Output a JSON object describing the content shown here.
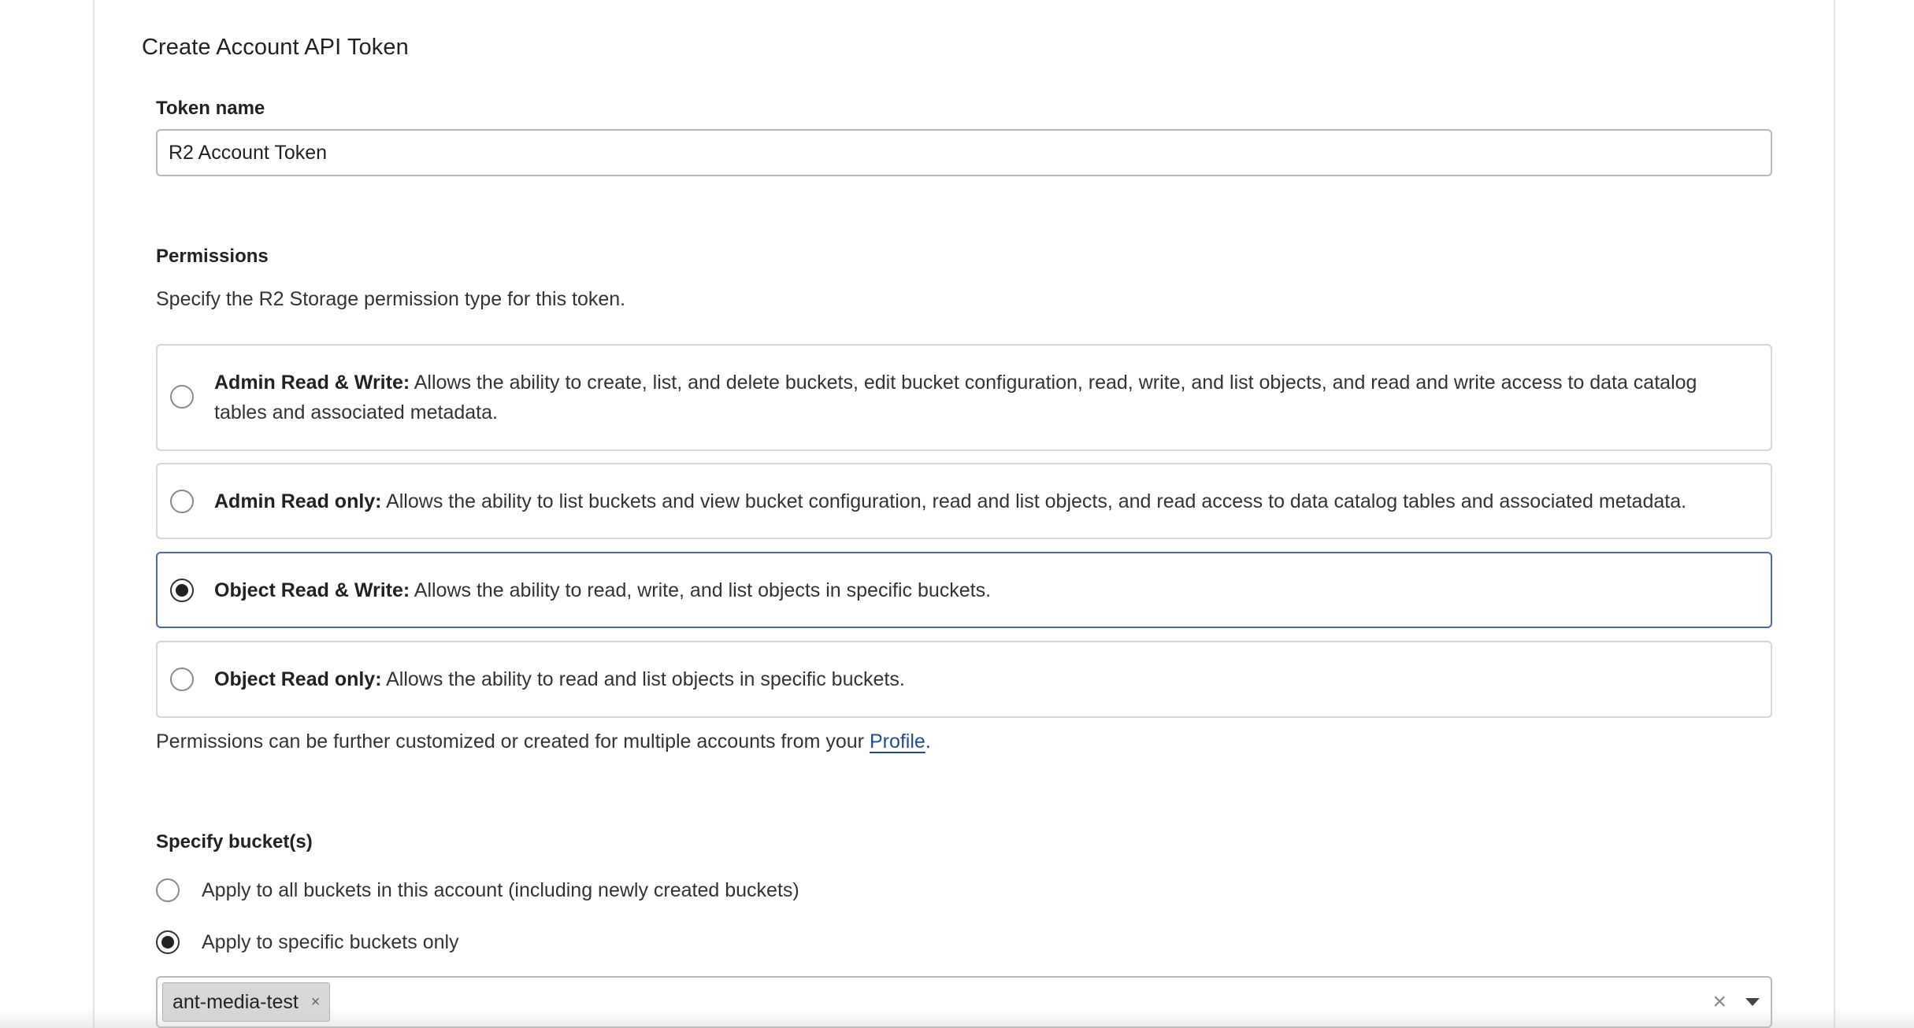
{
  "form": {
    "title": "Create Account API Token",
    "token_name_label": "Token name",
    "token_name_value": "R2 Account Token"
  },
  "permissions": {
    "label": "Permissions",
    "description": "Specify the R2 Storage permission type for this token.",
    "options": [
      {
        "title": "Admin Read & Write:",
        "text": " Allows the ability to create, list, and delete buckets, edit bucket configuration, read, write, and list objects, and read and write access to data catalog tables and associated metadata.",
        "selected": false
      },
      {
        "title": "Admin Read only:",
        "text": " Allows the ability to list buckets and view bucket configuration, read and list objects, and read access to data catalog tables and associated metadata.",
        "selected": false
      },
      {
        "title": "Object Read & Write:",
        "text": " Allows the ability to read, write, and list objects in specific buckets.",
        "selected": true
      },
      {
        "title": "Object Read only:",
        "text": " Allows the ability to read and list objects in specific buckets.",
        "selected": false
      }
    ],
    "note_prefix": "Permissions can be further customized or created for multiple accounts from your ",
    "note_link": "Profile",
    "note_suffix": "."
  },
  "buckets": {
    "label": "Specify bucket(s)",
    "option_all": "Apply to all buckets in this account (including newly created buckets)",
    "option_specific": "Apply to specific buckets only",
    "selected_option": "specific",
    "chips": [
      "ant-media-test"
    ],
    "chip_remove_glyph": "×",
    "clear_glyph": "×"
  },
  "colors": {
    "selected_border": "#4a6aa8",
    "link": "#1f4d9c",
    "chip_bg": "#d8d8d8"
  },
  "icons": {
    "chip_remove": "close-icon",
    "clear_all": "close-icon",
    "dropdown": "chevron-down-icon"
  }
}
